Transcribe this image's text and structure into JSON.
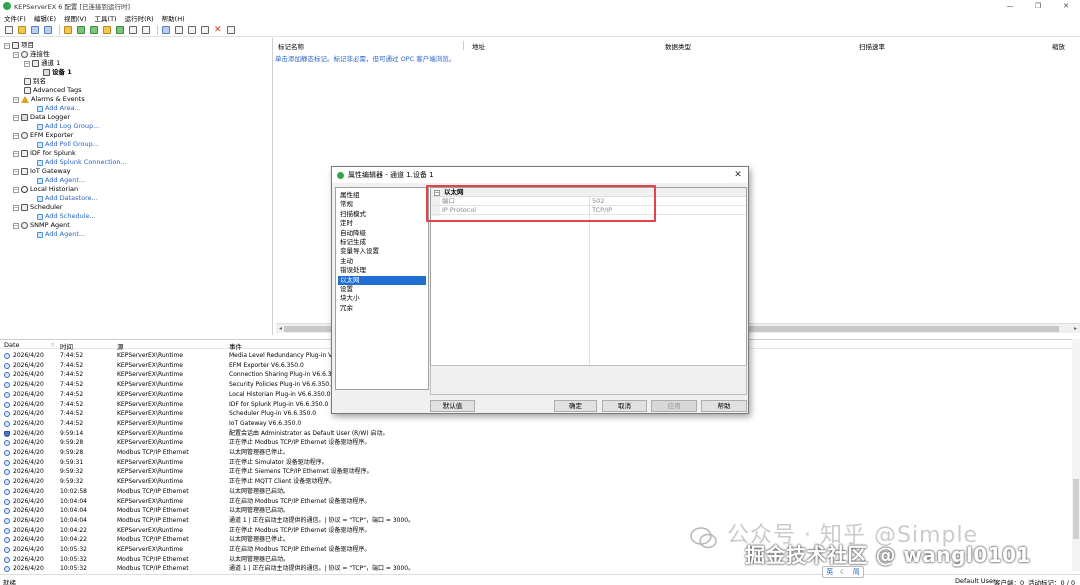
{
  "window": {
    "title": "KEPServerEX 6 配置 [已连接到运行时]"
  },
  "menu": [
    "文件(F)",
    "编辑(E)",
    "视图(V)",
    "工具(T)",
    "运行时(R)",
    "帮助(H)"
  ],
  "tree": {
    "root": "项目",
    "connectivity": "连接性",
    "channel": "通道 1",
    "device": "设备 1",
    "alias": "别名",
    "advanced_tags": "Advanced Tags",
    "alarms": "Alarms & Events",
    "add_area": "Add Area...",
    "data_logger": "Data Logger",
    "add_log_group": "Add Log Group...",
    "efm": "EFM Exporter",
    "add_poll_group": "Add Poll Group...",
    "idf_splunk": "IDF for Splunk",
    "add_splunk": "Add Splunk Connection...",
    "iot": "IoT Gateway",
    "add_agent": "Add Agent...",
    "historian": "Local Historian",
    "add_datastore": "Add Datastore...",
    "scheduler": "Scheduler",
    "add_schedule": "Add Schedule...",
    "snmp": "SNMP Agent",
    "add_agent2": "Add Agent..."
  },
  "tags": {
    "col_name": "标记名称",
    "col_address": "地址",
    "col_type": "数据类型",
    "col_rate": "扫描速率",
    "col_scale": "缩放",
    "hint": "单击添加静态标记。标记非必需，但可通过 OPC 客户端浏览。"
  },
  "log": {
    "headers": {
      "date": "Date",
      "time": "时间",
      "source": "源",
      "event": "事件"
    },
    "rows": [
      {
        "date": "2026/4/20",
        "time": "7:44:52",
        "source": "KEPServerEX\\Runtime",
        "event": "Media Level Redundancy Plug-in V6.6.350.0",
        "icon": "info"
      },
      {
        "date": "2026/4/20",
        "time": "7:44:52",
        "source": "KEPServerEX\\Runtime",
        "event": "EFM Exporter V6.6.350.0",
        "icon": "info"
      },
      {
        "date": "2026/4/20",
        "time": "7:44:52",
        "source": "KEPServerEX\\Runtime",
        "event": "Connection Sharing Plug-in V6.6.350.0",
        "icon": "info"
      },
      {
        "date": "2026/4/20",
        "time": "7:44:52",
        "source": "KEPServerEX\\Runtime",
        "event": "Security Policies Plug-in V6.6.350.0",
        "icon": "info"
      },
      {
        "date": "2026/4/20",
        "time": "7:44:52",
        "source": "KEPServerEX\\Runtime",
        "event": "Local Historian Plug-in V6.6.350.0",
        "icon": "info"
      },
      {
        "date": "2026/4/20",
        "time": "7:44:52",
        "source": "KEPServerEX\\Runtime",
        "event": "IDF for Splunk Plug-in V6.6.350.0",
        "icon": "info"
      },
      {
        "date": "2026/4/20",
        "time": "7:44:52",
        "source": "KEPServerEX\\Runtime",
        "event": "Scheduler Plug-in V6.6.350.0",
        "icon": "info"
      },
      {
        "date": "2026/4/20",
        "time": "7:44:52",
        "source": "KEPServerEX\\Runtime",
        "event": "IoT Gateway V6.6.350.0",
        "icon": "info"
      },
      {
        "date": "2026/4/20",
        "time": "9:59:14",
        "source": "KEPServerEX\\Runtime",
        "event": "配置会话由 Administrator as Default User (R/W) 启动。",
        "icon": "shield"
      },
      {
        "date": "2026/4/20",
        "time": "9:59:28",
        "source": "KEPServerEX\\Runtime",
        "event": "正在停止 Modbus TCP/IP Ethernet 设备驱动程序。",
        "icon": "info"
      },
      {
        "date": "2026/4/20",
        "time": "9:59:28",
        "source": "Modbus TCP/IP Ethernet",
        "event": "以太网管理器已停止。",
        "icon": "info"
      },
      {
        "date": "2026/4/20",
        "time": "9:59:31",
        "source": "KEPServerEX\\Runtime",
        "event": "正在停止 Simulator 设备驱动程序。",
        "icon": "info"
      },
      {
        "date": "2026/4/20",
        "time": "9:59:32",
        "source": "KEPServerEX\\Runtime",
        "event": "正在停止 Siemens TCP/IP Ethernet 设备驱动程序。",
        "icon": "info"
      },
      {
        "date": "2026/4/20",
        "time": "9:59:32",
        "source": "KEPServerEX\\Runtime",
        "event": "正在停止 MQTT Client 设备驱动程序。",
        "icon": "info"
      },
      {
        "date": "2026/4/20",
        "time": "10:02:58",
        "source": "Modbus TCP/IP Ethernet",
        "event": "以太网管理器已启动。",
        "icon": "info"
      },
      {
        "date": "2026/4/20",
        "time": "10:04:04",
        "source": "KEPServerEX\\Runtime",
        "event": "正在启动 Modbus TCP/IP Ethernet 设备驱动程序。",
        "icon": "info"
      },
      {
        "date": "2026/4/20",
        "time": "10:04:04",
        "source": "Modbus TCP/IP Ethernet",
        "event": "以太网管理器已启动。",
        "icon": "info"
      },
      {
        "date": "2026/4/20",
        "time": "10:04:04",
        "source": "Modbus TCP/IP Ethernet",
        "event": "通道 1 | 正在启动主动提供的通信。| 协议 = \"TCP\"，端口 = 3000。",
        "icon": "info"
      },
      {
        "date": "2026/4/20",
        "time": "10:04:22",
        "source": "KEPServerEX\\Runtime",
        "event": "正在停止 Modbus TCP/IP Ethernet 设备驱动程序。",
        "icon": "info"
      },
      {
        "date": "2026/4/20",
        "time": "10:04:22",
        "source": "Modbus TCP/IP Ethernet",
        "event": "以太网管理器已停止。",
        "icon": "info"
      },
      {
        "date": "2026/4/20",
        "time": "10:05:32",
        "source": "KEPServerEX\\Runtime",
        "event": "正在启动 Modbus TCP/IP Ethernet 设备驱动程序。",
        "icon": "info"
      },
      {
        "date": "2026/4/20",
        "time": "10:05:32",
        "source": "Modbus TCP/IP Ethernet",
        "event": "以太网管理器已启动。",
        "icon": "info"
      },
      {
        "date": "2026/4/20",
        "time": "10:05:32",
        "source": "Modbus TCP/IP Ethernet",
        "event": "通道 1 | 正在启动主动提供的通信。| 协议 = \"TCP\"，端口 = 3000。",
        "icon": "info"
      }
    ]
  },
  "status": {
    "left": "就绪",
    "user": "Default User",
    "clients": "客户端：0",
    "active_tags": "活动标记：0 / 0"
  },
  "dialog": {
    "title": "属性编辑器 - 通道 1.设备 1",
    "categories": [
      "属性组",
      "常规",
      "扫描模式",
      "定时",
      "自动降级",
      "标记生成",
      "变量导入设置",
      "主动",
      "错误处理",
      "以太网",
      "设置",
      "块大小",
      "冗余"
    ],
    "selected_category_index": 9,
    "group": "以太网",
    "properties": [
      {
        "name": "端口",
        "value": "502"
      },
      {
        "name": "IP Protocol",
        "value": "TCP/IP"
      }
    ],
    "buttons": {
      "defaults": "默认值",
      "ok": "确定",
      "cancel": "取消",
      "apply": "应用",
      "help": "帮助"
    }
  },
  "watermark": {
    "line1": "公众号 · 知乎 @Simple",
    "line2": "掘金技术社区 @ wangl0101"
  },
  "ime": {
    "lang": "英",
    "mode": "简"
  },
  "colors": {
    "selection": "#1e6fd0",
    "link": "#2a64c8",
    "highlight_box": "#e0434a",
    "app_icon": "#2ea84a"
  }
}
